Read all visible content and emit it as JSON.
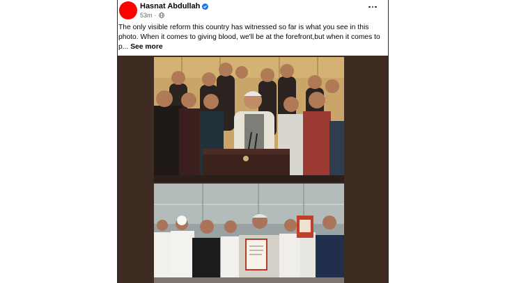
{
  "post": {
    "author": "Hasnat Abdullah",
    "time": "53m",
    "text": "The only visible reform this country has witnessed so far is what you see in this photo. When it comes to giving blood, we'll be at the forefront,but when it comes to p...",
    "see_more": "See more",
    "avatar_color": "#ff0000",
    "verified_color": "#1877f2",
    "icons": [
      "verified-badge-icon",
      "globe-icon",
      "more-options-icon"
    ]
  },
  "media": {
    "background": "#3e2c22",
    "photos": [
      {
        "name": "group-at-podium-photo"
      },
      {
        "name": "document-ceremony-photo"
      }
    ]
  }
}
